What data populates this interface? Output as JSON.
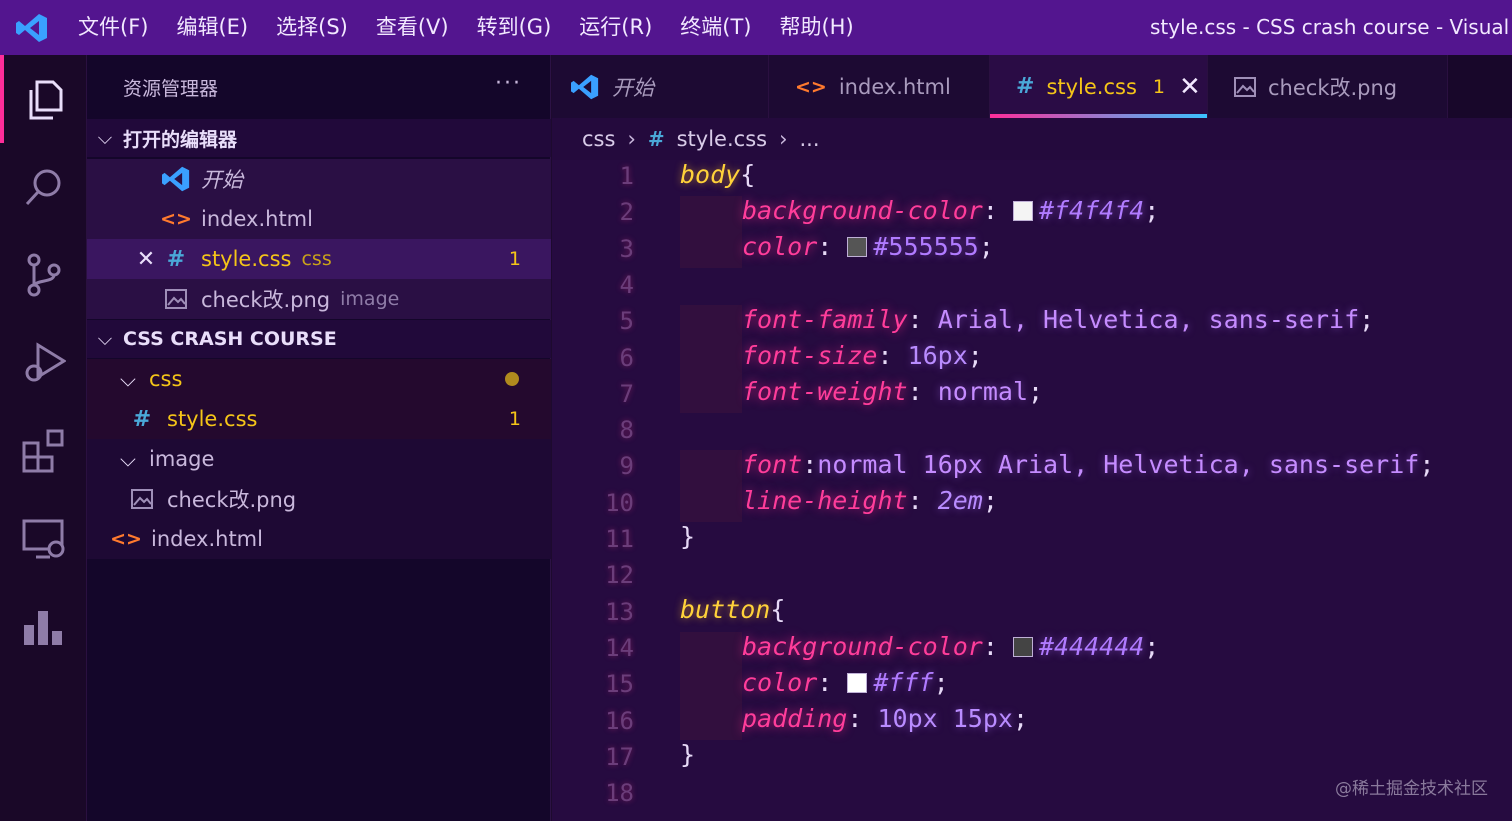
{
  "menu": [
    "文件(F)",
    "编辑(E)",
    "选择(S)",
    "查看(V)",
    "转到(G)",
    "运行(R)",
    "终端(T)",
    "帮助(H)"
  ],
  "window_title": "style.css - CSS crash course - Visual Studio Code",
  "sidebar": {
    "title": "资源管理器",
    "more": "···",
    "open_editors": {
      "label": "打开的编辑器",
      "items": [
        {
          "name": "开始"
        },
        {
          "name": "index.html"
        },
        {
          "name": "style.css",
          "type": "css",
          "badge": "1"
        },
        {
          "name": "check改.png",
          "type": "image"
        }
      ]
    },
    "project": {
      "label": "CSS CRASH COURSE",
      "folder_css": "css",
      "file_style": "style.css",
      "file_style_badge": "1",
      "folder_image": "image",
      "file_png": "check改.png",
      "file_index": "index.html"
    }
  },
  "tabs": [
    {
      "label": "开始"
    },
    {
      "label": "index.html"
    },
    {
      "label": "style.css",
      "badge": "1"
    },
    {
      "label": "check改.png"
    }
  ],
  "breadcrumb": {
    "folder": "css",
    "file": "style.css",
    "more": "..."
  },
  "line_numbers": [
    "1",
    "2",
    "3",
    "4",
    "5",
    "6",
    "7",
    "8",
    "9",
    "10",
    "11",
    "12",
    "13",
    "14",
    "15",
    "16",
    "17",
    "18"
  ],
  "code": {
    "l1_sel": "body",
    "l1_brace": "{",
    "l2_prop": "background-color",
    "l2_val": "#f4f4f4",
    "l3_prop": "color",
    "l3_val": "#555555",
    "l5_prop": "font-family",
    "l5_val": "Arial, Helvetica, sans-serif",
    "l6_prop": "font-size",
    "l6_val": "16px",
    "l7_prop": "font-weight",
    "l7_val": "normal",
    "l9_prop": "font",
    "l9_val": "normal 16px Arial, Helvetica, sans-serif",
    "l10_prop": "line-height",
    "l10_val": "2em",
    "l11": "}",
    "l13_sel": "button",
    "l13_brace": "{",
    "l14_prop": "background-color",
    "l14_val": "#444444",
    "l15_prop": "color",
    "l15_val": "#fff",
    "l16_prop": "padding",
    "l16_val": "10px 15px",
    "l17": "}"
  },
  "colors": {
    "swatch_f4": "#f4f4f4",
    "swatch_55": "#555555",
    "swatch_44": "#444444",
    "swatch_fff": "#ffffff",
    "accent": "#ff2d9a",
    "titlebar": "#53158f"
  },
  "watermark": "@稀土掘金技术社区"
}
